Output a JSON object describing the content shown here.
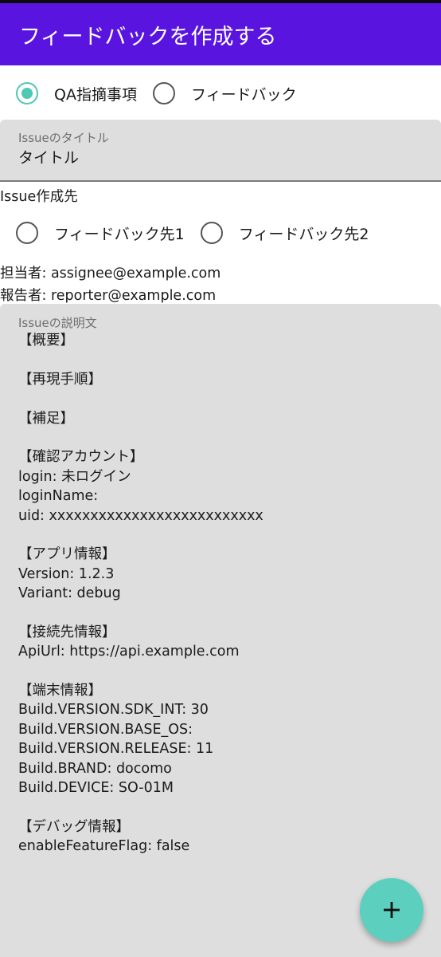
{
  "app_bar": {
    "title": "フィードバックを作成する"
  },
  "type_selector": {
    "options": [
      {
        "label": "QA指摘事項",
        "selected": true
      },
      {
        "label": "フィードバック",
        "selected": false
      }
    ]
  },
  "title_field": {
    "label": "Issueのタイトル",
    "value": "タイトル"
  },
  "destination": {
    "heading": "Issue作成先",
    "options": [
      {
        "label": "フィードバック先1",
        "selected": false
      },
      {
        "label": "フィードバック先2",
        "selected": false
      }
    ]
  },
  "people": {
    "assignee": "担当者: assignee@example.com",
    "reporter": "報告者: reporter@example.com"
  },
  "description_field": {
    "label": "Issueの説明文",
    "lines": [
      "【概要】",
      "",
      "【再現手順】",
      "",
      "【補足】",
      "",
      "【確認アカウント】",
      "login: 未ログイン",
      "loginName:",
      "uid: xxxxxxxxxxxxxxxxxxxxxxxxxx",
      "",
      "【アプリ情報】",
      "Version: 1.2.3",
      "Variant: debug",
      "",
      "【接続先情報】",
      "ApiUrl: https://api.example.com",
      "",
      "【端末情報】",
      "Build.VERSION.SDK_INT: 30",
      "Build.VERSION.BASE_OS:",
      "Build.VERSION.RELEASE: 11",
      "Build.BRAND: docomo",
      "Build.DEVICE: SO-01M",
      "",
      "【デバッグ情報】",
      "enableFeatureFlag: false"
    ]
  },
  "fab": {
    "icon": "plus-icon"
  },
  "colors": {
    "app_bar": "#5a14e0",
    "accent": "#4fc8b4",
    "fab": "#5ccfbf",
    "field_background": "#dedede"
  }
}
